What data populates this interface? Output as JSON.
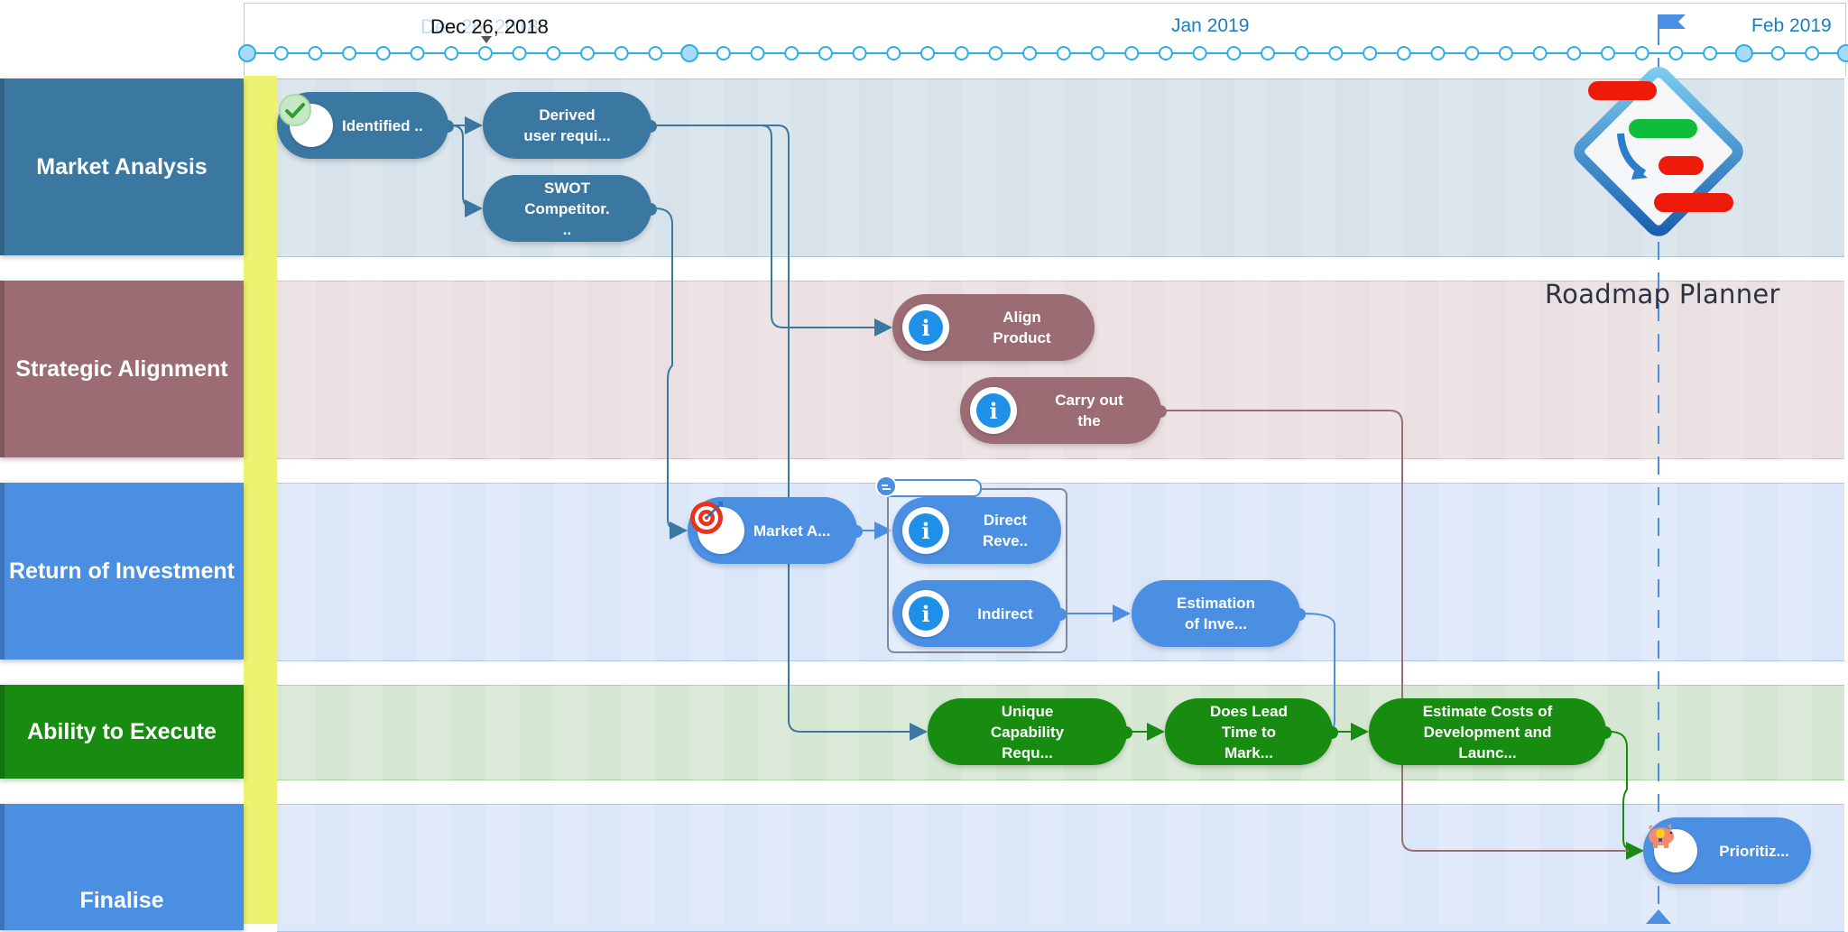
{
  "timeline": {
    "current_date_label": "Dec 26, 2018",
    "ghost_date_label": "Dec 26, 2018",
    "months": [
      "Jan 2019",
      "Feb 2019"
    ],
    "marker_icon": "flag-icon"
  },
  "app": {
    "title": "Roadmap Planner",
    "logo_icon": "roadmap-planner-logo-icon"
  },
  "lanes": [
    {
      "label": "Market Analysis",
      "color": "#3a78a2",
      "bg": "#d7e2eb"
    },
    {
      "label": "Strategic Alignment",
      "color": "#9b6c73",
      "bg": "#eae0e2"
    },
    {
      "label": "Return of Investment",
      "color": "#4a8fe2",
      "bg": "#dbe7f8"
    },
    {
      "label": "Ability to Execute",
      "color": "#178c10",
      "bg": "#d5e7d2"
    },
    {
      "label": "Finalise",
      "color": "#4a8fe2",
      "bg": "#dbe7f8"
    }
  ],
  "tasks": {
    "identified": {
      "label": "Identified ..",
      "icon": "check-icon"
    },
    "derived": {
      "label": "Derived\nuser requi..."
    },
    "swot": {
      "label": "SWOT\nCompetitor.\n.."
    },
    "align": {
      "label": "Align\nProduct",
      "icon": "info-icon"
    },
    "carry": {
      "label": "Carry out\nthe",
      "icon": "info-icon"
    },
    "market_a": {
      "label": "Market A...",
      "icon": "target-icon"
    },
    "direct": {
      "label": "Direct\nReve..",
      "icon": "info-icon"
    },
    "indirect": {
      "label": "Indirect",
      "icon": "info-icon"
    },
    "estimation": {
      "label": "Estimation\nof Inve..."
    },
    "unique": {
      "label": "Unique\nCapability\nRequ..."
    },
    "lead": {
      "label": "Does Lead\nTime to\nMark..."
    },
    "costs": {
      "label": "Estimate Costs of\nDevelopment and\nLaunc..."
    },
    "prioritiz": {
      "label": "Prioritiz...",
      "icon": "piggy-bank-idea-icon"
    }
  },
  "info_glyph": "i"
}
